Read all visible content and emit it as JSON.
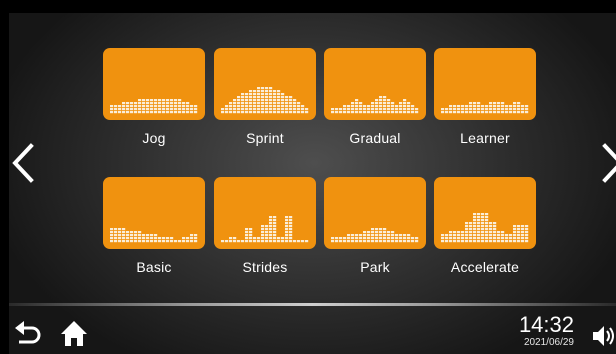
{
  "navigation": {
    "prev_icon": "chevron-left-icon",
    "next_icon": "chevron-right-icon"
  },
  "programs": [
    {
      "label": "Jog",
      "profile": [
        3,
        3,
        3,
        4,
        4,
        4,
        4,
        5,
        5,
        5,
        5,
        5,
        5,
        5,
        5,
        5,
        5,
        5,
        4,
        4,
        3,
        3
      ]
    },
    {
      "label": "Sprint",
      "profile": [
        2,
        3,
        4,
        5,
        6,
        7,
        7,
        8,
        8,
        9,
        9,
        9,
        9,
        8,
        8,
        7,
        6,
        6,
        5,
        4,
        3,
        2
      ]
    },
    {
      "label": "Gradual",
      "profile": [
        2,
        2,
        2,
        3,
        3,
        4,
        5,
        4,
        3,
        3,
        4,
        5,
        6,
        6,
        5,
        4,
        3,
        4,
        5,
        4,
        3,
        2
      ]
    },
    {
      "label": "Learner",
      "profile": [
        2,
        2,
        3,
        3,
        3,
        3,
        3,
        4,
        4,
        4,
        3,
        3,
        4,
        4,
        4,
        4,
        3,
        3,
        4,
        4,
        3,
        3
      ]
    },
    {
      "label": "Basic",
      "profile": [
        5,
        5,
        5,
        5,
        4,
        4,
        4,
        4,
        3,
        3,
        3,
        3,
        2,
        2,
        2,
        2,
        1,
        1,
        2,
        2,
        3,
        3
      ]
    },
    {
      "label": "Strides",
      "profile": [
        1,
        1,
        2,
        2,
        1,
        1,
        5,
        5,
        2,
        2,
        6,
        6,
        9,
        9,
        2,
        2,
        9,
        9,
        1,
        1,
        1,
        1
      ]
    },
    {
      "label": "Park",
      "profile": [
        2,
        2,
        2,
        2,
        3,
        3,
        3,
        3,
        4,
        4,
        5,
        5,
        5,
        5,
        4,
        4,
        3,
        3,
        3,
        3,
        2,
        2
      ]
    },
    {
      "label": "Accelerate",
      "profile": [
        3,
        3,
        4,
        4,
        4,
        4,
        7,
        7,
        10,
        10,
        10,
        10,
        7,
        7,
        4,
        4,
        3,
        3,
        6,
        6,
        6,
        6
      ]
    }
  ],
  "colors": {
    "tile": "#f0920f",
    "bars": "#fbeed8"
  },
  "footer": {
    "back_icon": "back-arrow-icon",
    "home_icon": "home-icon",
    "time": "14:32",
    "date": "2021/06/29",
    "volume_icon": "volume-icon"
  }
}
